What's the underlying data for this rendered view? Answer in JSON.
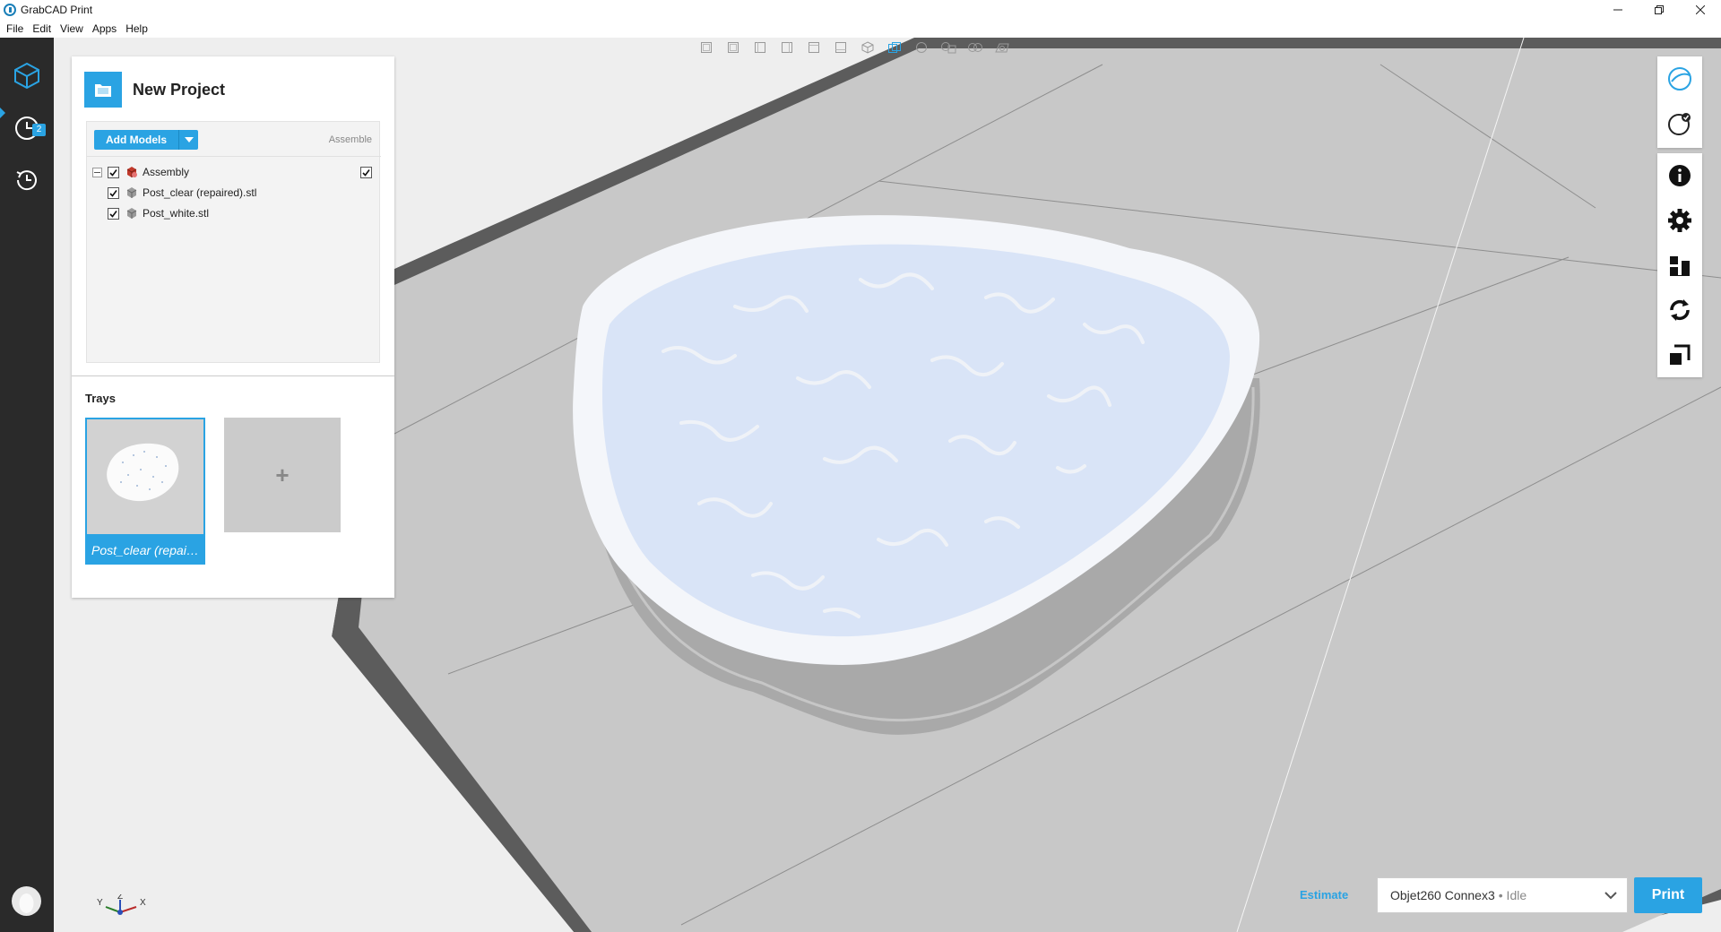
{
  "window": {
    "title": "GrabCAD Print",
    "controls": [
      "minimize-icon",
      "restore-icon",
      "close-icon"
    ]
  },
  "menu": [
    "File",
    "Edit",
    "View",
    "Apps",
    "Help"
  ],
  "rail": {
    "items": [
      {
        "name": "models-view",
        "icon": "cube-icon",
        "active": true
      },
      {
        "name": "queue-view",
        "icon": "clock-icon",
        "badge": "2"
      },
      {
        "name": "history-view",
        "icon": "history-icon"
      }
    ]
  },
  "project": {
    "title": "New Project",
    "add_models_label": "Add Models",
    "assemble_label": "Assemble",
    "tree": {
      "assembly": "Assembly",
      "models": [
        "Post_clear (repaired).stl",
        "Post_white.stl"
      ]
    }
  },
  "trays": {
    "label": "Trays",
    "items": [
      "Post_clear (repaired).stl"
    ],
    "add_symbol": "+"
  },
  "right_tools": [
    "sphere-view-icon",
    "progress-icon",
    "info-icon",
    "gear-icon",
    "align-icon",
    "rotate-icon",
    "scale-icon"
  ],
  "bottom": {
    "estimate_label": "Estimate",
    "printer_name": "Objet260 Connex3",
    "printer_status": "• Idle",
    "print_label": "Print"
  },
  "axis_labels": {
    "y": "Y",
    "z": "Z",
    "x": "X"
  },
  "colors": {
    "accent": "#2aa3e3",
    "rail": "#2a2a2a",
    "tray_floor": "#c8c8c8",
    "tray_frame": "#5a5a5a",
    "model_fill": "#d9e4f7"
  }
}
